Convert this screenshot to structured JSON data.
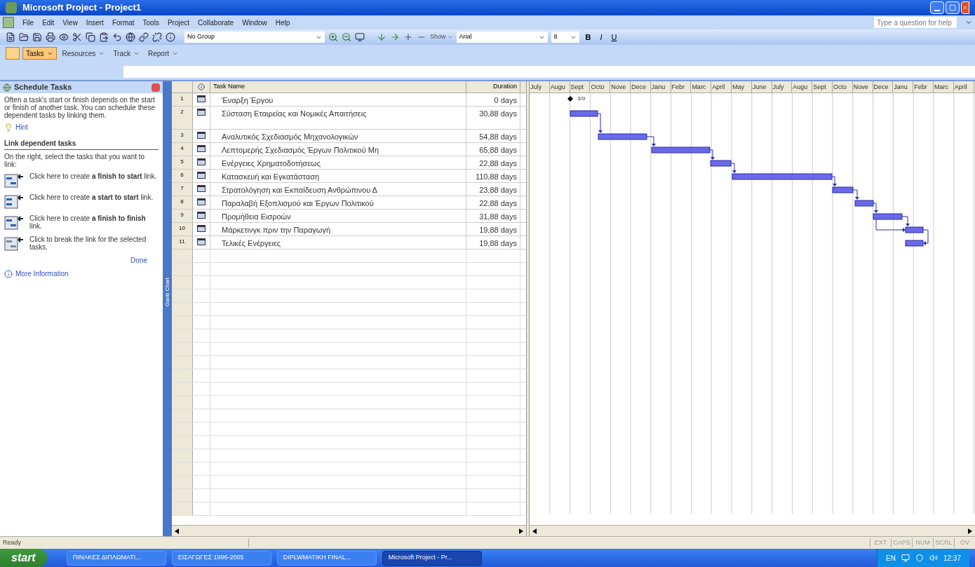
{
  "window": {
    "title": "Microsoft Project - Project1"
  },
  "menu": [
    "File",
    "Edit",
    "View",
    "Insert",
    "Format",
    "Tools",
    "Project",
    "Collaborate",
    "Window",
    "Help"
  ],
  "help_box": {
    "placeholder": "Type a question for help"
  },
  "toolbar": {
    "group_select": "No Group",
    "show_button": "Show",
    "font": "Arial",
    "font_size": "8",
    "bold": "B",
    "italic": "I",
    "underline": "U"
  },
  "guide_bar": [
    {
      "label": "Tasks",
      "selected": true
    },
    {
      "label": "Resources",
      "selected": false
    },
    {
      "label": "Track",
      "selected": false
    },
    {
      "label": "Report",
      "selected": false
    }
  ],
  "side_pane": {
    "title": "Schedule Tasks",
    "intro": "Often a task's start or finish depends on the start or finish of another task. You can schedule these dependent tasks by linking them.",
    "hint": "Hint",
    "heading": "Link dependent tasks",
    "instruction": "On the right, select the tasks that you want to link:",
    "actions": [
      {
        "kind": "finish-to-start",
        "text": "Click here to create **a finish to start** link."
      },
      {
        "kind": "start-to-start",
        "text": "Click here to create **a start to start** link."
      },
      {
        "kind": "finish-to-finish",
        "text": "Click here to create **a finish to finish** link."
      },
      {
        "kind": "unlink",
        "text": "Click to break the link for the selected tasks."
      }
    ],
    "done": "Done",
    "more_info": "More Information"
  },
  "view_bar": {
    "label": "Gantt Chart"
  },
  "table": {
    "columns": [
      "Task Name",
      "Duration"
    ],
    "rows": [
      {
        "id": "1",
        "name": "Έναρξη Έργου",
        "duration": "0 days",
        "tall": false
      },
      {
        "id": "2",
        "name": "Σύσταση Εταιρείας και Νομικές Απαιτήσεις",
        "duration": "30,88 days",
        "tall": true
      },
      {
        "id": "3",
        "name": "Αναλυτικός Σχεδιασμός Μηχανολογικών",
        "duration": "54,88 days",
        "tall": false
      },
      {
        "id": "4",
        "name": "Λεπτομερής Σχεδιασμός Έργων Πολιτικού Μη",
        "duration": "65,88 days",
        "tall": false
      },
      {
        "id": "5",
        "name": "Ενέργειες Χρηματοδοτήσεως",
        "duration": "22,88 days",
        "tall": false
      },
      {
        "id": "6",
        "name": "Κατασκευή και Εγκατάσταση",
        "duration": "110,88 days",
        "tall": false
      },
      {
        "id": "7",
        "name": "Στρατολόγηση και Εκπαίδευση Ανθρώπινου Δ",
        "duration": "23,88 days",
        "tall": false
      },
      {
        "id": "8",
        "name": "Παραλαβή Εξοπλισμού και Έργων Πολιτικού",
        "duration": "22,88 days",
        "tall": false
      },
      {
        "id": "9",
        "name": "Προμήθεια Εισροών",
        "duration": "31,88 days",
        "tall": false
      },
      {
        "id": "10",
        "name": "Μάρκετινγκ πριν την Παραγωγή",
        "duration": "19,88 days",
        "tall": false
      },
      {
        "id": "11",
        "name": "Τελικές Ενέργειες",
        "duration": "19,88 days",
        "tall": false
      }
    ]
  },
  "gantt": {
    "months": [
      "July",
      "Augu",
      "Sept",
      "Octo",
      "Nove",
      "Dece",
      "Janu",
      "Febr",
      "Marc",
      "April",
      "May",
      "June",
      "July",
      "Augu",
      "Sept",
      "Octo",
      "Nove",
      "Dece",
      "Janu",
      "Febr",
      "Marc",
      "April"
    ],
    "milestone_label": "3/9"
  },
  "status_bar": {
    "text": "Ready",
    "indicators": [
      "EXT",
      "CAPS",
      "NUM",
      "SCRL",
      "OV"
    ]
  },
  "taskbar": {
    "start": "start",
    "buttons": [
      {
        "label": "ΠΙΝΑΚΕΣ ΔΙΠΛΩΜΑΤΙ...",
        "selected": false
      },
      {
        "label": "ΕΙΣΑΓΩΓΕΣ 1996-2005",
        "selected": false
      },
      {
        "label": "DIPLWMATIKH FINAL...",
        "selected": false
      },
      {
        "label": "Microsoft Project - Pr...",
        "selected": true
      }
    ],
    "language": "EN",
    "clock": "12:37"
  }
}
